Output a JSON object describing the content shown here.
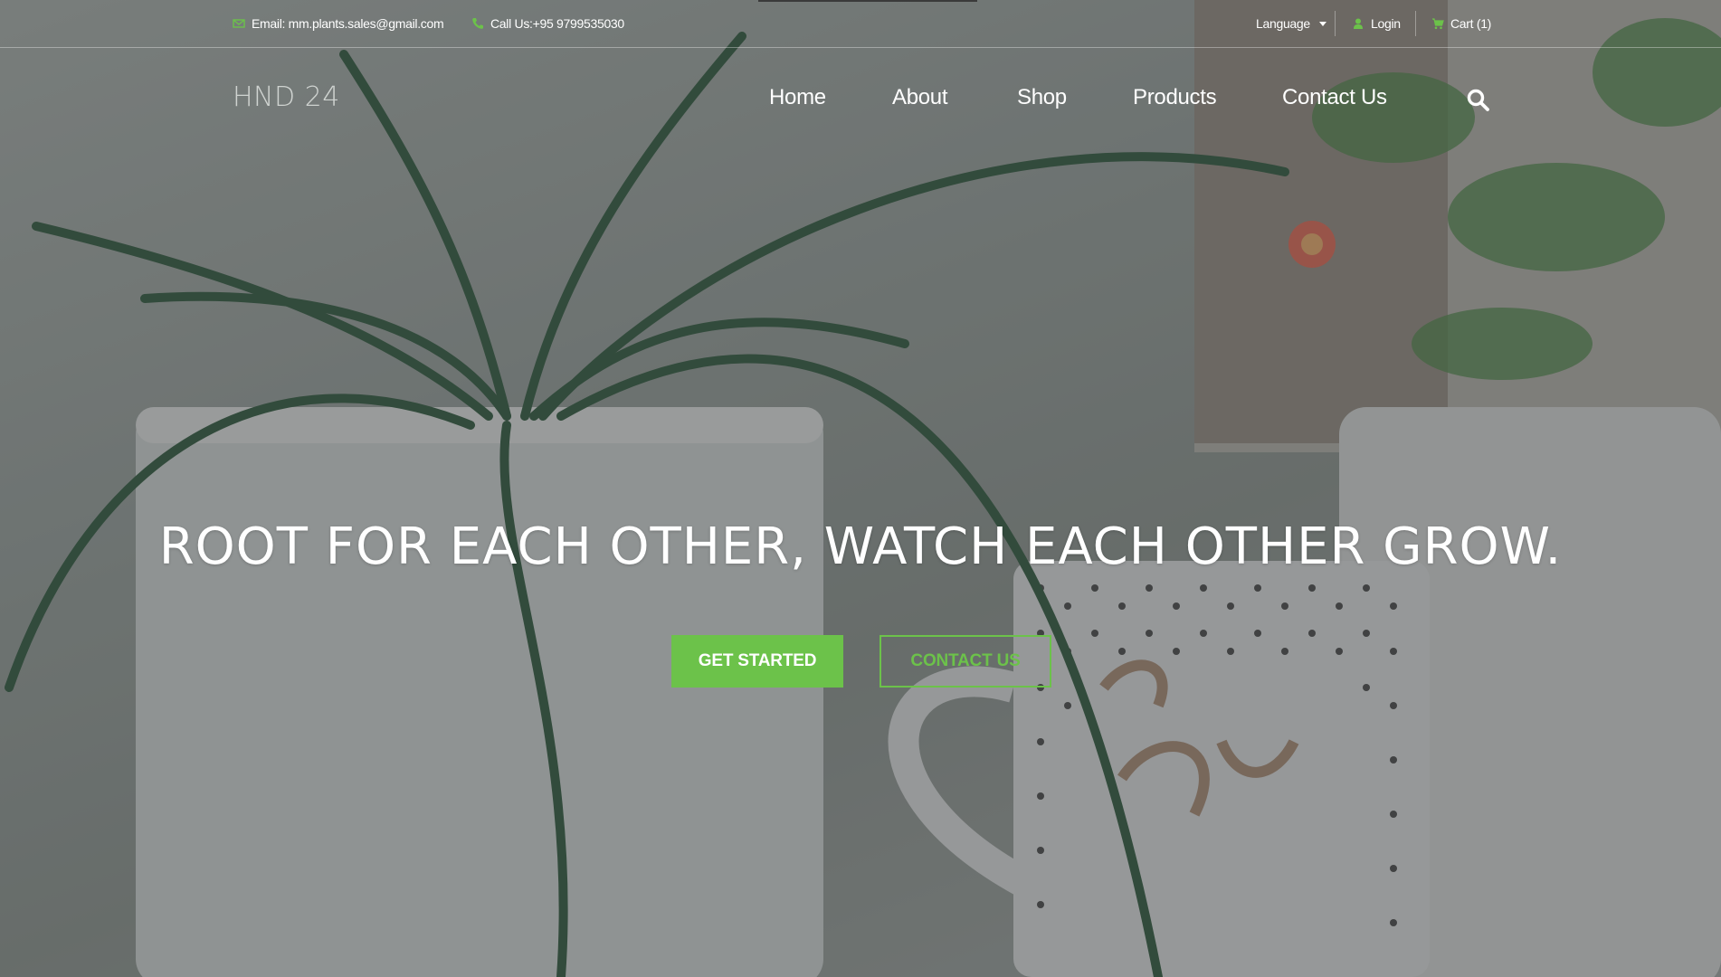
{
  "topbar": {
    "email": "Email: mm.plants.sales@gmail.com",
    "phone": "Call Us:+95 9799535030",
    "language": "Language",
    "login": "Login",
    "cart": "Cart (1)"
  },
  "nav": {
    "logo": "HND 24",
    "links": [
      "Home",
      "About",
      "Shop",
      "Products",
      "Contact Us"
    ]
  },
  "hero": {
    "headline": "ROOT FOR EACH OTHER, WATCH EACH OTHER GROW.",
    "primary_button": "GET STARTED",
    "secondary_button": "CONTACT US"
  },
  "colors": {
    "accent": "#6cc24a"
  }
}
